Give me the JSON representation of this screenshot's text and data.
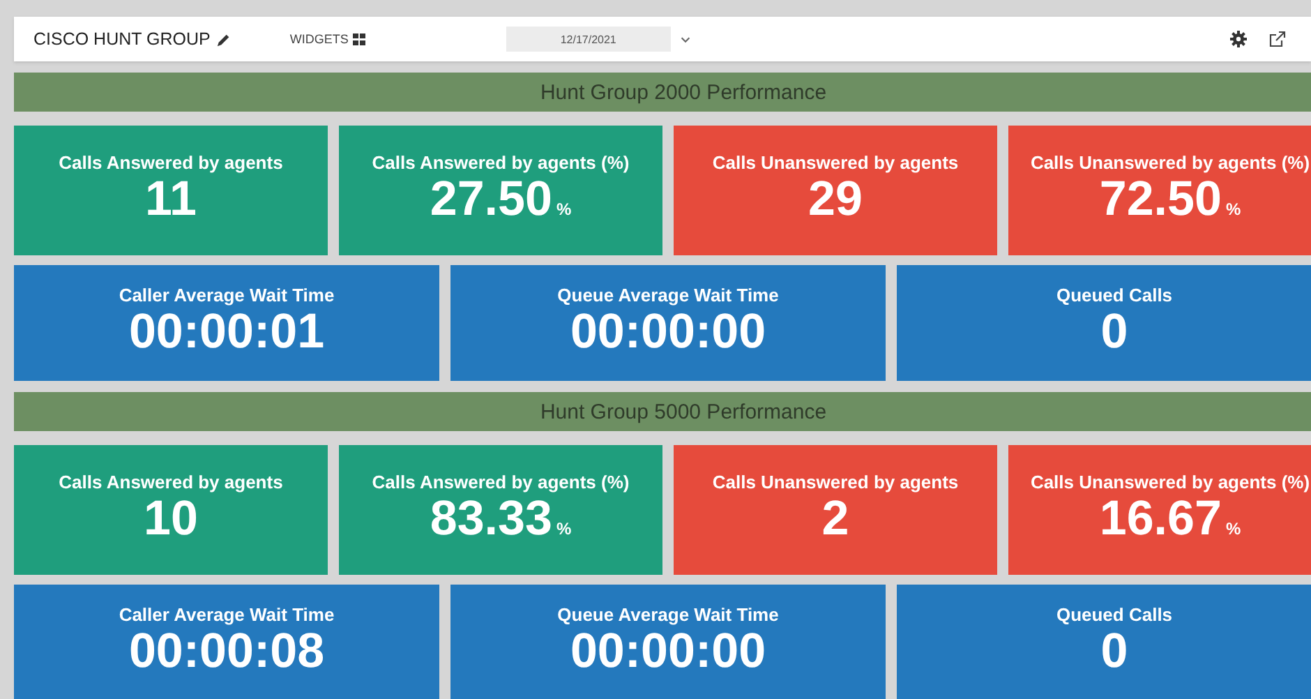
{
  "toolbar": {
    "title": "CISCO HUNT GROUP",
    "widgets_label": "WIDGETS",
    "date": "12/17/2021"
  },
  "sections": [
    {
      "title": "Hunt Group 2000 Performance",
      "call_metrics": [
        {
          "kind": "answered",
          "label": "Calls Answered by agents",
          "value": "11"
        },
        {
          "kind": "answered",
          "label": "Calls Answered by agents (%)",
          "value": "27.50",
          "unit": "%"
        },
        {
          "kind": "unanswered",
          "label": "Calls Unanswered by agents",
          "value": "29"
        },
        {
          "kind": "unanswered",
          "label": "Calls Unanswered by agents (%)",
          "value": "72.50",
          "unit": "%"
        }
      ],
      "wait_metrics": [
        {
          "kind": "info",
          "label": "Caller Average Wait Time",
          "value": "00:00:01"
        },
        {
          "kind": "info",
          "label": "Queue Average Wait Time",
          "value": "00:00:00"
        },
        {
          "kind": "info",
          "label": "Queued Calls",
          "value": "0"
        }
      ]
    },
    {
      "title": "Hunt Group 5000 Performance",
      "call_metrics": [
        {
          "kind": "answered",
          "label": "Calls Answered by agents",
          "value": "10"
        },
        {
          "kind": "answered",
          "label": "Calls Answered by agents (%)",
          "value": "83.33",
          "unit": "%"
        },
        {
          "kind": "unanswered",
          "label": "Calls Unanswered by agents",
          "value": "2"
        },
        {
          "kind": "unanswered",
          "label": "Calls Unanswered by agents (%)",
          "value": "16.67",
          "unit": "%"
        }
      ],
      "wait_metrics": [
        {
          "kind": "info",
          "label": "Caller Average Wait Time",
          "value": "00:00:08"
        },
        {
          "kind": "info",
          "label": "Queue Average Wait Time",
          "value": "00:00:00"
        },
        {
          "kind": "info",
          "label": "Queued Calls",
          "value": "0"
        }
      ]
    }
  ]
}
